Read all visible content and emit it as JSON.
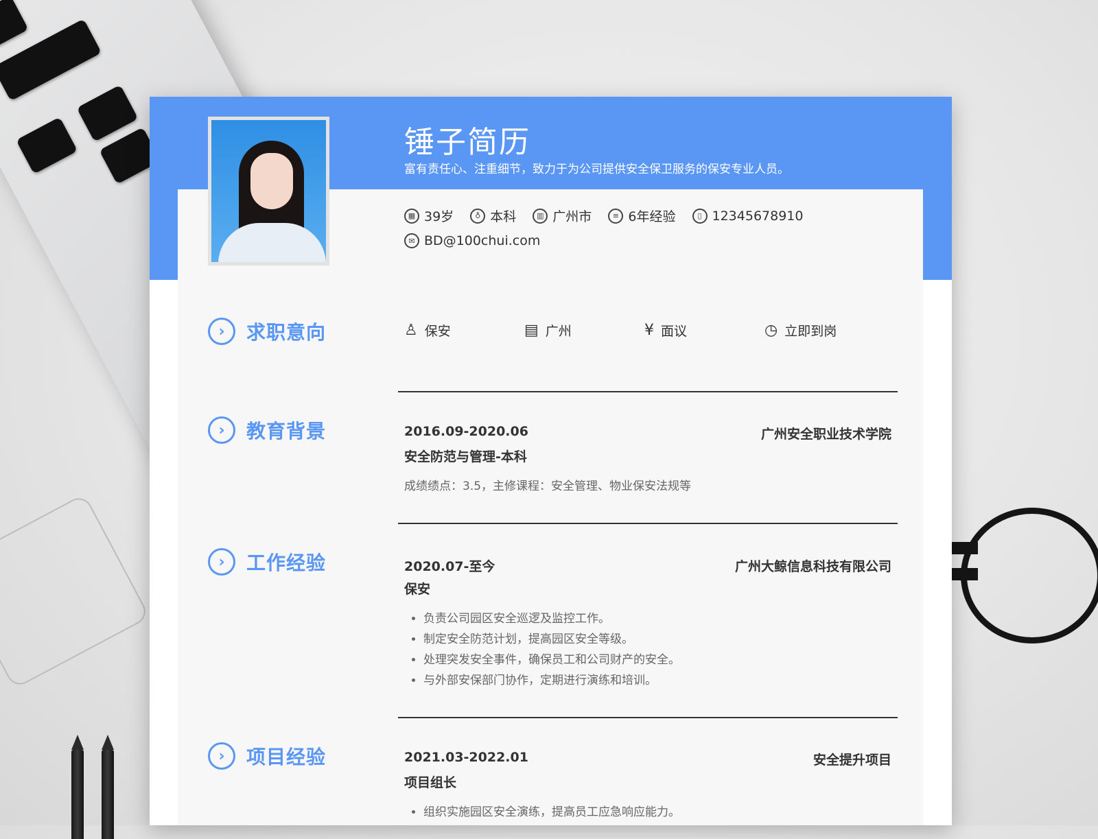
{
  "header": {
    "name": "锤子简历",
    "tagline": "富有责任心、注重细节，致力于为公司提供安全保卫服务的保安专业人员。"
  },
  "info": [
    {
      "icon": "calendar-icon",
      "glyph": "▦",
      "value": "39岁"
    },
    {
      "icon": "education-icon",
      "glyph": "♁",
      "value": "本科"
    },
    {
      "icon": "building-icon",
      "glyph": "▥",
      "value": "广州市"
    },
    {
      "icon": "experience-icon",
      "glyph": "≡",
      "value": "6年经验"
    },
    {
      "icon": "phone-icon",
      "glyph": "▯",
      "value": "12345678910"
    },
    {
      "icon": "mail-icon",
      "glyph": "✉",
      "value": "BD@100chui.com"
    }
  ],
  "sections": {
    "intent": "求职意向",
    "education": "教育背景",
    "work": "工作经验",
    "project": "项目经验"
  },
  "intent": [
    {
      "icon": "tie-icon",
      "glyph": "♙",
      "value": "保安"
    },
    {
      "icon": "city-icon",
      "glyph": "▤",
      "value": "广州"
    },
    {
      "icon": "salary-icon",
      "glyph": "¥",
      "value": "面议"
    },
    {
      "icon": "clock-icon",
      "glyph": "◷",
      "value": "立即到岗"
    }
  ],
  "education": {
    "period": "2016.09-2020.06",
    "school": "广州安全职业技术学院",
    "major": "安全防范与管理-本科",
    "desc": "成绩绩点：3.5，主修课程：安全管理、物业保安法规等"
  },
  "work": {
    "period": "2020.07-至今",
    "company": "广州大鲸信息科技有限公司",
    "role": "保安",
    "bullets": [
      "负责公司园区安全巡逻及监控工作。",
      "制定安全防范计划，提高园区安全等级。",
      "处理突发安全事件，确保员工和公司财产的安全。",
      "与外部安保部门协作，定期进行演练和培训。"
    ]
  },
  "project": {
    "period": "2021.03-2022.01",
    "name": "安全提升项目",
    "role": "项目组长",
    "bullets": [
      "组织实施园区安全演练，提高员工应急响应能力。"
    ]
  },
  "colors": {
    "accent": "#5a97f4",
    "panel": "#f7f7f7",
    "text": "#333333"
  }
}
